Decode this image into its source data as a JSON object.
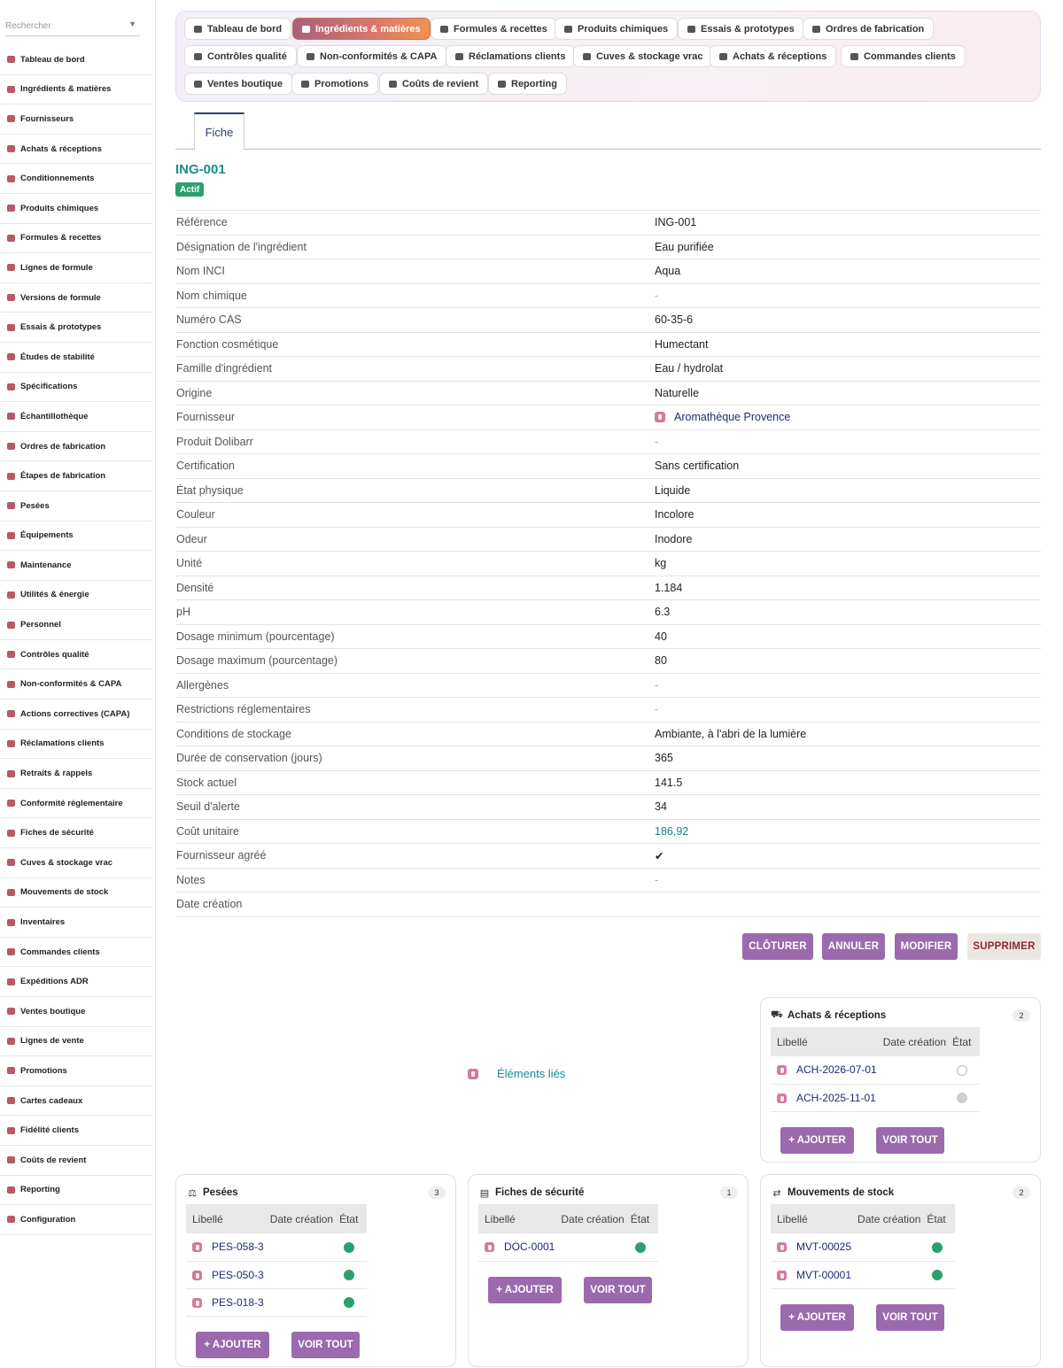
{
  "search": {
    "placeholder": "Rechercher"
  },
  "sidebar": {
    "items": [
      {
        "label": "Tableau de bord"
      },
      {
        "label": "Ingrédients & matières"
      },
      {
        "label": "Fournisseurs"
      },
      {
        "label": "Achats & réceptions"
      },
      {
        "label": "Conditionnements"
      },
      {
        "label": "Produits chimiques"
      },
      {
        "label": "Formules & recettes"
      },
      {
        "label": "Lignes de formule"
      },
      {
        "label": "Versions de formule"
      },
      {
        "label": "Essais & prototypes"
      },
      {
        "label": "Études de stabilité"
      },
      {
        "label": "Spécifications"
      },
      {
        "label": "Échantillothèque"
      },
      {
        "label": "Ordres de fabrication"
      },
      {
        "label": "Étapes de fabrication"
      },
      {
        "label": "Pesées"
      },
      {
        "label": "Équipements"
      },
      {
        "label": "Maintenance"
      },
      {
        "label": "Utilités & énergie"
      },
      {
        "label": "Personnel"
      },
      {
        "label": "Contrôles qualité"
      },
      {
        "label": "Non-conformités & CAPA"
      },
      {
        "label": "Actions correctives (CAPA)"
      },
      {
        "label": "Réclamations clients"
      },
      {
        "label": "Retraits & rappels"
      },
      {
        "label": "Conformité réglementaire"
      },
      {
        "label": "Fiches de sécurité"
      },
      {
        "label": "Cuves & stockage vrac"
      },
      {
        "label": "Mouvements de stock"
      },
      {
        "label": "Inventaires"
      },
      {
        "label": "Commandes clients"
      },
      {
        "label": "Expéditions ADR"
      },
      {
        "label": "Ventes boutique"
      },
      {
        "label": "Lignes de vente"
      },
      {
        "label": "Promotions"
      },
      {
        "label": "Cartes cadeaux"
      },
      {
        "label": "Fidélité clients"
      },
      {
        "label": "Coûts de revient"
      },
      {
        "label": "Reporting"
      },
      {
        "label": "Configuration"
      }
    ]
  },
  "topnav": {
    "items": [
      {
        "label": "Tableau de bord"
      },
      {
        "label": "Ingrédients & matières"
      },
      {
        "label": "Formules & recettes"
      },
      {
        "label": "Produits chimiques"
      },
      {
        "label": "Essais & prototypes"
      },
      {
        "label": "Ordres de fabrication"
      },
      {
        "label": "Contrôles qualité"
      },
      {
        "label": "Non-conformités & CAPA"
      },
      {
        "label": "Réclamations clients"
      },
      {
        "label": "Cuves & stockage vrac"
      },
      {
        "label": "Achats & réceptions"
      },
      {
        "label": "Commandes clients"
      },
      {
        "label": "Ventes boutique"
      },
      {
        "label": "Promotions"
      },
      {
        "label": "Coûts de revient"
      },
      {
        "label": "Reporting"
      }
    ],
    "active_color": "#d9786a"
  },
  "tab": {
    "label": "Fiche"
  },
  "record": {
    "title": "ING-001",
    "status": "Actif",
    "fields": [
      {
        "label": "Référence",
        "value": "ING-001"
      },
      {
        "label": "Désignation de l'ingrédient",
        "value": "Eau purifiée"
      },
      {
        "label": "Nom INCI",
        "value": "Aqua"
      },
      {
        "label": "Nom chimique",
        "value": "-"
      },
      {
        "label": "Numéro CAS",
        "value": "60-35-6"
      },
      {
        "label": "Fonction cosmétique",
        "value": "Humectant"
      },
      {
        "label": "Famille d'ingrédient",
        "value": "Eau / hydrolat"
      },
      {
        "label": "Origine",
        "value": "Naturelle"
      },
      {
        "label": "Fournisseur",
        "value": "Aromathèque Provence"
      },
      {
        "label": "Produit Dolibarr",
        "value": "-"
      },
      {
        "label": "Certification",
        "value": "Sans certification"
      },
      {
        "label": "État physique",
        "value": "Liquide"
      },
      {
        "label": "Couleur",
        "value": "Incolore"
      },
      {
        "label": "Odeur",
        "value": "Inodore"
      },
      {
        "label": "Unité",
        "value": "kg"
      },
      {
        "label": "Densité",
        "value": "1.184"
      },
      {
        "label": "pH",
        "value": "6.3"
      },
      {
        "label": "Dosage minimum (pourcentage)",
        "value": "40"
      },
      {
        "label": "Dosage maximum (pourcentage)",
        "value": "80"
      },
      {
        "label": "Allergènes",
        "value": "-"
      },
      {
        "label": "Restrictions réglementaires",
        "value": "-"
      },
      {
        "label": "Conditions de stockage",
        "value": "Ambiante, à l'abri de la lumière"
      },
      {
        "label": "Durée de conservation (jours)",
        "value": "365"
      },
      {
        "label": "Stock actuel",
        "value": "141.5"
      },
      {
        "label": "Seuil d'alerte",
        "value": "34"
      },
      {
        "label": "Coût unitaire",
        "value": "186,92"
      },
      {
        "label": "Fournisseur agréé",
        "value": "✔"
      },
      {
        "label": "Notes",
        "value": "-"
      },
      {
        "label": "Date création",
        "value": ""
      }
    ]
  },
  "actions": {
    "close": "Clôturer",
    "cancel": "Annuler",
    "edit": "Modifier",
    "delete": "Supprimer"
  },
  "linked": {
    "label": "Éléments liés"
  },
  "table_headers": {
    "label": "Libellé",
    "date": "Date création",
    "state": "État"
  },
  "box_buttons": {
    "add": "+ AJOUTER",
    "view_all": "VOIR TOUT"
  },
  "boxes": {
    "achats": {
      "title": "Achats & réceptions",
      "count": "2",
      "rows": [
        {
          "label": "ACH-2026-07-01",
          "state": "empty"
        },
        {
          "label": "ACH-2025-11-01",
          "state": "grey"
        }
      ]
    },
    "pesees": {
      "title": "Pesées",
      "count": "3",
      "rows": [
        {
          "label": "PES-058-3",
          "state": "ok"
        },
        {
          "label": "PES-050-3",
          "state": "ok"
        },
        {
          "label": "PES-018-3",
          "state": "ok"
        }
      ]
    },
    "fiches": {
      "title": "Fiches de sécurité",
      "count": "1",
      "rows": [
        {
          "label": "DOC-0001",
          "state": "ok"
        }
      ]
    },
    "mouvements": {
      "title": "Mouvements de stock",
      "count": "2",
      "rows": [
        {
          "label": "MVT-00025",
          "state": "ok"
        },
        {
          "label": "MVT-00001",
          "state": "ok"
        }
      ]
    }
  },
  "colors": {
    "accent": "#9b6aad",
    "teal": "#1b8a8c",
    "success": "#2aa06e",
    "link": "#1e2a78"
  }
}
